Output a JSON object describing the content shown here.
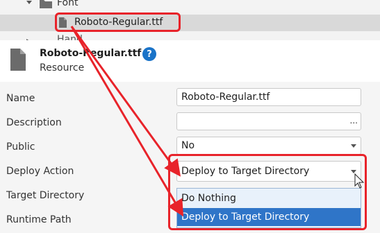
{
  "tree": {
    "folder_label": "Font",
    "selected_file": "Roboto-Regular.ttf",
    "next_label_partial": "Hand"
  },
  "header": {
    "resource_name": "Roboto-Regular.ttf",
    "resource_type": "Resource",
    "help_glyph": "?"
  },
  "properties": {
    "name_label": "Name",
    "name_value": "Roboto-Regular.ttf",
    "description_label": "Description",
    "description_value": "",
    "description_button": "...",
    "public_label": "Public",
    "public_value": "No",
    "deploy_label": "Deploy Action",
    "deploy_value": "Deploy to Target Directory",
    "target_label": "Target Directory",
    "runtime_label": "Runtime Path"
  },
  "dropdown": {
    "options": [
      "Do Nothing",
      "Deploy to Target Directory"
    ],
    "selected_index": 1
  },
  "colors": {
    "highlight": "#e8232a",
    "selection": "#2f75c8",
    "help_badge": "#1a73c8"
  }
}
